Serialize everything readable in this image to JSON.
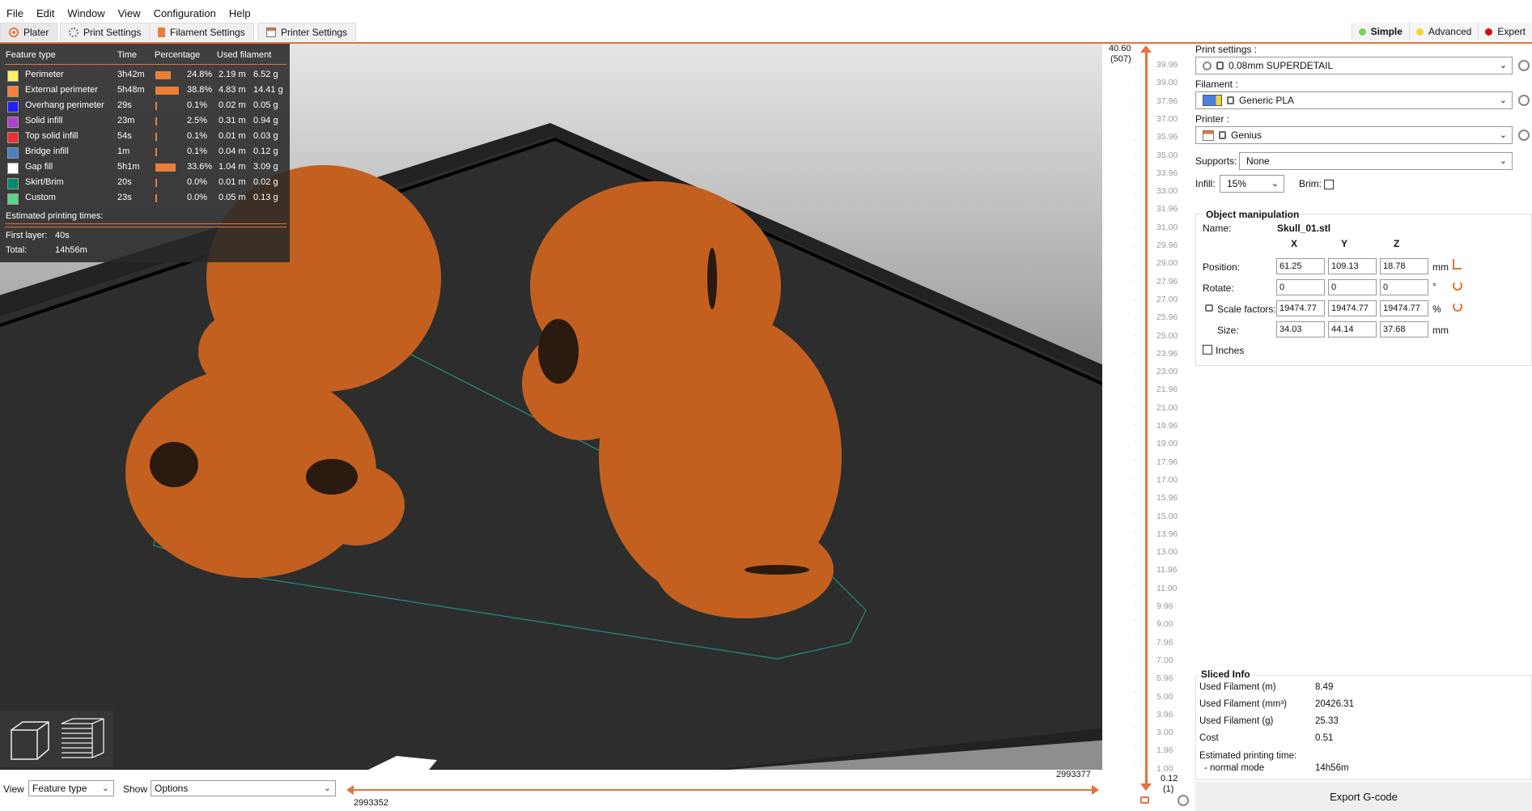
{
  "menu": [
    "File",
    "Edit",
    "Window",
    "View",
    "Configuration",
    "Help"
  ],
  "tabs": [
    {
      "label": "Plater",
      "icon": "plater-icon"
    },
    {
      "label": "Print Settings",
      "icon": "gear-icon"
    },
    {
      "label": "Filament Settings",
      "icon": "filament-spool-icon"
    },
    {
      "label": "Printer Settings",
      "icon": "printer-icon"
    }
  ],
  "modes": [
    {
      "label": "Simple",
      "color": "#7dd35a"
    },
    {
      "label": "Advanced",
      "color": "#f2d33a"
    },
    {
      "label": "Expert",
      "color": "#d01010"
    }
  ],
  "legend": {
    "headers": [
      "Feature type",
      "Time",
      "Percentage",
      "Used filament"
    ],
    "rows": [
      {
        "name": "Perimeter",
        "color": "#fff066",
        "time": "3h42m",
        "pct": "24.8%",
        "pct_value": 24.8,
        "length": "2.19 m",
        "weight": "6.52 g"
      },
      {
        "name": "External perimeter",
        "color": "#ff7d38",
        "time": "5h48m",
        "pct": "38.8%",
        "pct_value": 38.8,
        "length": "4.83 m",
        "weight": "14.41 g"
      },
      {
        "name": "Overhang perimeter",
        "color": "#1f1fff",
        "time": "29s",
        "pct": "0.1%",
        "pct_value": 0.1,
        "length": "0.02 m",
        "weight": "0.05 g"
      },
      {
        "name": "Solid infill",
        "color": "#b03fd0",
        "time": "23m",
        "pct": "2.5%",
        "pct_value": 2.5,
        "length": "0.31 m",
        "weight": "0.94 g"
      },
      {
        "name": "Top solid infill",
        "color": "#f03030",
        "time": "54s",
        "pct": "0.1%",
        "pct_value": 0.1,
        "length": "0.01 m",
        "weight": "0.03 g"
      },
      {
        "name": "Bridge infill",
        "color": "#4a7fc0",
        "time": "1m",
        "pct": "0.1%",
        "pct_value": 0.1,
        "length": "0.04 m",
        "weight": "0.12 g"
      },
      {
        "name": "Gap fill",
        "color": "#ffffff",
        "time": "5h1m",
        "pct": "33.6%",
        "pct_value": 33.6,
        "length": "1.04 m",
        "weight": "3.09 g"
      },
      {
        "name": "Skirt/Brim",
        "color": "#008a6a",
        "time": "20s",
        "pct": "0.0%",
        "pct_value": 0.0,
        "length": "0.01 m",
        "weight": "0.02 g"
      },
      {
        "name": "Custom",
        "color": "#5ed38a",
        "time": "23s",
        "pct": "0.0%",
        "pct_value": 0.0,
        "length": "0.05 m",
        "weight": "0.13 g"
      }
    ],
    "est_title": "Estimated printing times:",
    "first_layer_label": "First layer:",
    "first_layer_value": "40s",
    "total_label": "Total:",
    "total_value": "14h56m"
  },
  "vslider": {
    "top_value": "40.60",
    "top_layer": "(507)",
    "bottom_value": "0.12",
    "bottom_layer": "(1)",
    "ticks": [
      "39.96",
      "39.00",
      "37.96",
      "37.00",
      "35.96",
      "35.00",
      "33.96",
      "33.00",
      "31.96",
      "31.00",
      "29.96",
      "29.00",
      "27.96",
      "27.00",
      "25.96",
      "25.00",
      "23.96",
      "23.00",
      "21.96",
      "21.00",
      "19.96",
      "19.00",
      "17.96",
      "17.00",
      "15.96",
      "15.00",
      "13.96",
      "13.00",
      "11.96",
      "11.00",
      "9.96",
      "9.00",
      "7.96",
      "7.00",
      "5.96",
      "5.00",
      "3.96",
      "3.00",
      "1.96",
      "1.00"
    ]
  },
  "bottom": {
    "view_label": "View",
    "view_value": "Feature type",
    "show_label": "Show",
    "show_value": "Options",
    "hslider_left": "2993352",
    "hslider_right": "2993377"
  },
  "panel": {
    "print_settings_label": "Print settings :",
    "print_settings_value": "0.08mm SUPERDETAIL",
    "filament_label": "Filament :",
    "filament_value": "Generic PLA",
    "printer_label": "Printer :",
    "printer_value": "Genius",
    "supports_label": "Supports:",
    "supports_value": "None",
    "infill_label": "Infill:",
    "infill_value": "15%",
    "brim_label": "Brim:"
  },
  "object_manipulation": {
    "title": "Object manipulation",
    "name_label": "Name:",
    "name_value": "Skull_01.stl",
    "axes": [
      "X",
      "Y",
      "Z"
    ],
    "position_label": "Position:",
    "position": [
      "61.25",
      "109.13",
      "18.78"
    ],
    "position_unit": "mm",
    "rotate_label": "Rotate:",
    "rotate": [
      "0",
      "0",
      "0"
    ],
    "rotate_unit": "°",
    "scale_label": "Scale factors:",
    "scale": [
      "19474.77",
      "19474.77",
      "19474.77"
    ],
    "scale_unit": "%",
    "size_label": "Size:",
    "size": [
      "34.03",
      "44.14",
      "37.68"
    ],
    "size_unit": "mm",
    "inches_label": "Inches"
  },
  "sliced_info": {
    "title": "Sliced Info",
    "rows": [
      {
        "label": "Used Filament (m)",
        "value": "8.49"
      },
      {
        "label": "Used Filament (mm³)",
        "value": "20426.31"
      },
      {
        "label": "Used Filament (g)",
        "value": "25.33"
      },
      {
        "label": "Cost",
        "value": "0.51"
      }
    ],
    "est_label": "Estimated printing time:",
    "normal_label": "- normal mode",
    "normal_value": "14h56m"
  },
  "export_label": "Export G-code"
}
